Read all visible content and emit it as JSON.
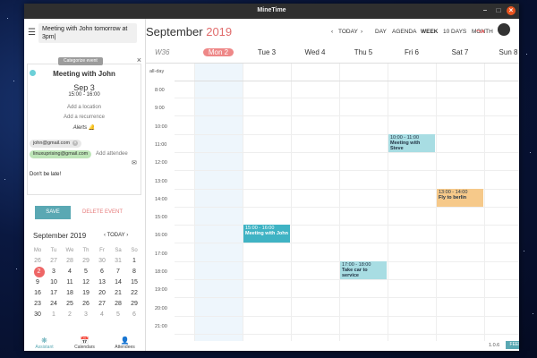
{
  "window": {
    "title": "MineTime",
    "minimize": "–",
    "maximize": "□",
    "close": "×"
  },
  "quick_input": {
    "value": "Meeting with John tomorrow at 3pm|"
  },
  "event_card": {
    "categorize_label": "Categorize event",
    "title": "Meeting with John",
    "date": "Sep 3",
    "time": "15:00 - 16:00",
    "add_location": "Add a location",
    "add_recurrence": "Add a recurrence",
    "alerts_label": "Alerts",
    "attendees": [
      "john@gmail.com",
      "linuxuprising@gmail.com"
    ],
    "add_attendee": "Add attendee",
    "note": "Don't be late!",
    "save_label": "SAVE",
    "delete_label": "DELETE EVENT"
  },
  "mini_calendar": {
    "title": "September 2019",
    "today_label": "TODAY",
    "weekdays": [
      "Mo",
      "Tu",
      "We",
      "Th",
      "Fr",
      "Sa",
      "So"
    ],
    "weeks": [
      [
        "26",
        "27",
        "28",
        "29",
        "30",
        "31",
        "1"
      ],
      [
        "2",
        "3",
        "4",
        "5",
        "6",
        "7",
        "8"
      ],
      [
        "9",
        "10",
        "11",
        "12",
        "13",
        "14",
        "15"
      ],
      [
        "16",
        "17",
        "18",
        "19",
        "20",
        "21",
        "22"
      ],
      [
        "23",
        "24",
        "25",
        "26",
        "27",
        "28",
        "29"
      ],
      [
        "30",
        "1",
        "2",
        "3",
        "4",
        "5",
        "6"
      ]
    ]
  },
  "bottom_nav": [
    {
      "label": "Assistant",
      "icon": "assistant-icon"
    },
    {
      "label": "Calendars",
      "icon": "calendar-icon"
    },
    {
      "label": "Attendees",
      "icon": "attendees-icon"
    }
  ],
  "header": {
    "month": "September",
    "year": "2019",
    "today_label": "TODAY",
    "views": [
      "DAY",
      "AGENDA",
      "WEEK",
      "10 DAYS",
      "MONTH"
    ],
    "active_view": "WEEK"
  },
  "week": {
    "label": "W36",
    "days": [
      "Mon 2",
      "Tue 3",
      "Wed 4",
      "Thu 5",
      "Fri 6",
      "Sat 7",
      "Sun 8"
    ],
    "allday_label": "all-day",
    "hours": [
      "8:00",
      "9:00",
      "10:00",
      "11:00",
      "12:00",
      "13:00",
      "14:00",
      "15:00",
      "16:00",
      "17:00",
      "18:00",
      "19:00",
      "20:00",
      "21:00"
    ]
  },
  "events": [
    {
      "time": "10:00 - 11:00",
      "title": "Meeting with Steve",
      "day": 4,
      "start": 10,
      "end": 11
    },
    {
      "time": "13:00 - 14:00",
      "title": "Fly to berlin",
      "day": 5,
      "start": 13,
      "end": 14
    },
    {
      "time": "15:00 - 16:00",
      "title": "Meeting with John",
      "day": 1,
      "start": 15,
      "end": 16
    },
    {
      "time": "17:00 - 18:00",
      "title": "Take car to service",
      "day": 3,
      "start": 17,
      "end": 18
    }
  ],
  "footer": {
    "version": "1.0.6",
    "feedback_label": "FEEDBACK"
  },
  "colors": {
    "accent": "#5aa8b3",
    "today": "#e88888",
    "event_blue": "#a8dde3",
    "event_teal": "#3fb3c4",
    "event_orange": "#f6c98a"
  }
}
